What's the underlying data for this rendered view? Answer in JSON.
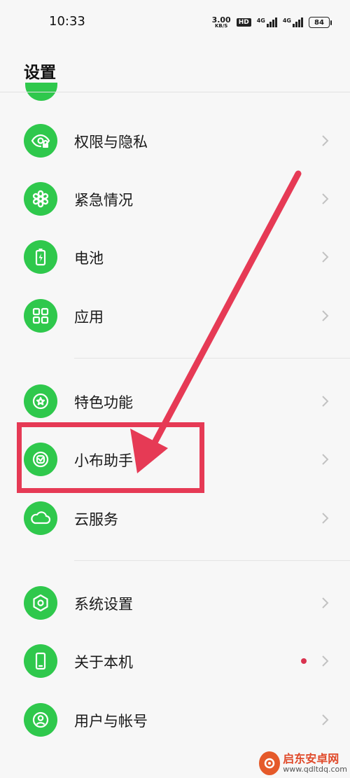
{
  "status_bar": {
    "time": "10:33",
    "speed_value": "3.00",
    "speed_unit": "KB/S",
    "hd": "HD",
    "net1": "4G",
    "net2": "4G",
    "battery": "84"
  },
  "header": {
    "title": "设置"
  },
  "settings": {
    "items": [
      {
        "label": "权限与隐私",
        "icon": "eye-lock-icon"
      },
      {
        "label": "紧急情况",
        "icon": "asterisk-icon"
      },
      {
        "label": "电池",
        "icon": "battery-icon"
      },
      {
        "label": "应用",
        "icon": "apps-grid-icon"
      },
      {
        "label": "特色功能",
        "icon": "star-circle-icon"
      },
      {
        "label": "小布助手",
        "icon": "assistant-icon"
      },
      {
        "label": "云服务",
        "icon": "cloud-icon"
      },
      {
        "label": "系统设置",
        "icon": "hexagon-gear-icon"
      },
      {
        "label": "关于本机",
        "icon": "phone-icon",
        "has_dot": true
      },
      {
        "label": "用户与帐号",
        "icon": "user-icon"
      }
    ]
  },
  "colors": {
    "icon_bg": "#2fc84c",
    "annotation": "#e63a55",
    "badge_dot": "#d9334f"
  },
  "watermark": {
    "name": "启东安卓网",
    "url": "www.qdltdq.com"
  }
}
